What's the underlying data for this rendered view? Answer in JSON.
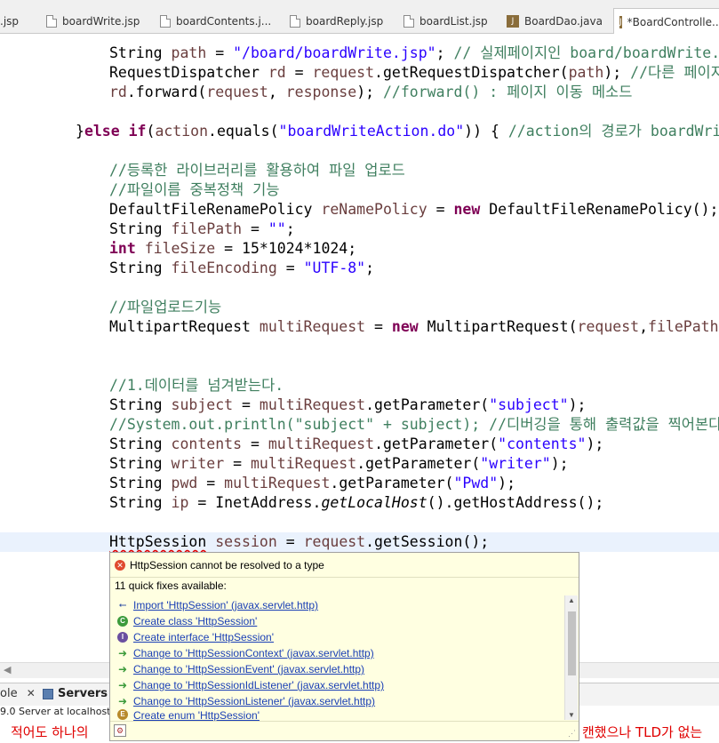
{
  "tabs": [
    {
      "label": ".jsp",
      "icon": "file-icon"
    },
    {
      "label": "boardWrite.jsp",
      "icon": "file-icon"
    },
    {
      "label": "boardContents.j...",
      "icon": "file-icon"
    },
    {
      "label": "boardReply.jsp",
      "icon": "file-icon"
    },
    {
      "label": "boardList.jsp",
      "icon": "file-icon"
    },
    {
      "label": "BoardDao.java",
      "icon": "java-icon"
    },
    {
      "label": "*BoardControlle...",
      "icon": "java-icon",
      "active": true
    }
  ],
  "code": {
    "l1": {
      "a": "String ",
      "b": "path",
      "c": " = ",
      "d": "\"/board/boardWrite.jsp\"",
      "e": "; ",
      "f": "// 실제페이지인 board/boardWrite.js"
    },
    "l2": {
      "a": "RequestDispatcher ",
      "b": "rd",
      "c": " = ",
      "d": "request",
      "e": ".getRequestDispatcher(",
      "f": "path",
      "g": "); ",
      "h": "//다른 페이지"
    },
    "l3": {
      "a": "rd",
      "b": ".forward(",
      "c": "request",
      "d": ", ",
      "e": "response",
      "f": "); ",
      "g": "//forward() : 페이지 이동 메소드"
    },
    "l4": {
      "a": "}",
      "b": "else",
      "c": " ",
      "d": "if",
      "e": "(",
      "f": "action",
      "g": ".equals(",
      "h": "\"boardWriteAction.do\"",
      "i": ")) { ",
      "j": "//action의 경로가 boardWrit"
    },
    "l5": {
      "a": "//등록한 라이브러리를 활용하여 파일 업로드"
    },
    "l6": {
      "a": "//파일이름 중복정책 기능"
    },
    "l7": {
      "a": "DefaultFileRenamePolicy ",
      "b": "reNamePolicy",
      "c": " = ",
      "d": "new",
      "e": " DefaultFileRenamePolicy();"
    },
    "l8": {
      "a": "String ",
      "b": "filePath",
      "c": " = ",
      "d": "\"\"",
      "e": ";"
    },
    "l9": {
      "a": "int",
      "b": " ",
      "c": "fileSize",
      "d": " = 15*1024*1024;"
    },
    "l10": {
      "a": "String ",
      "b": "fileEncoding",
      "c": " = ",
      "d": "\"UTF-8\"",
      "e": ";"
    },
    "l11": {
      "a": "//파일업로드기능"
    },
    "l12": {
      "a": "MultipartRequest ",
      "b": "multiRequest",
      "c": " = ",
      "d": "new",
      "e": " MultipartRequest(",
      "f": "request",
      "g": ",",
      "h": "filePath"
    },
    "l13": {
      "a": "//1.데이터를 넘겨받는다."
    },
    "l14": {
      "a": "String ",
      "b": "subject",
      "c": " = ",
      "d": "multiRequest",
      "e": ".getParameter(",
      "f": "\"subject\"",
      "g": ");"
    },
    "l15": {
      "a": "//System.out.println(\"subject\" + subject); //디버깅을 통해 출력값을 찍어본다"
    },
    "l16": {
      "a": "String ",
      "b": "contents",
      "c": " = ",
      "d": "multiRequest",
      "e": ".getParameter(",
      "f": "\"contents\"",
      "g": ");"
    },
    "l17": {
      "a": "String ",
      "b": "writer",
      "c": " = ",
      "d": "multiRequest",
      "e": ".getParameter(",
      "f": "\"writer\"",
      "g": ");"
    },
    "l18": {
      "a": "String ",
      "b": "pwd",
      "c": " = ",
      "d": "multiRequest",
      "e": ".getParameter(",
      "f": "\"Pwd\"",
      "g": ");"
    },
    "l19": {
      "a": "String ",
      "b": "ip",
      "c": " = InetAddress.",
      "d": "getLocalHost",
      "e": "().getHostAddress();"
    },
    "l20": {
      "a": "HttpSession",
      "b": " ",
      "c": "session",
      "d": " = ",
      "e": "request",
      "f": ".getSession();"
    }
  },
  "quickfix": {
    "title": "HttpSession cannot be resolved to a type",
    "count": "11 quick fixes available:",
    "items": [
      {
        "label": "Import 'HttpSession' (javax.servlet.http)",
        "icon": "import-icon"
      },
      {
        "label": "Create class 'HttpSession'",
        "icon": "class-icon"
      },
      {
        "label": "Create interface 'HttpSession'",
        "icon": "interface-icon"
      },
      {
        "label": "Change to 'HttpSessionContext' (javax.servlet.http)",
        "icon": "change-arrow-icon"
      },
      {
        "label": "Change to 'HttpSessionEvent' (javax.servlet.http)",
        "icon": "change-arrow-icon"
      },
      {
        "label": "Change to 'HttpSessionIdListener' (javax.servlet.http)",
        "icon": "change-arrow-icon"
      },
      {
        "label": "Change to 'HttpSessionListener' (javax.servlet.http)",
        "icon": "change-arrow-icon"
      },
      {
        "label": "Create enum 'HttpSession'",
        "icon": "enum-icon"
      }
    ]
  },
  "panel": {
    "console_tab": "ole",
    "servers_tab": "Servers",
    "server_entry": "9.0 Server at localhost"
  },
  "console": {
    "left": "적어도 하나의",
    "right": "캔했으나 TLD가 없는"
  }
}
